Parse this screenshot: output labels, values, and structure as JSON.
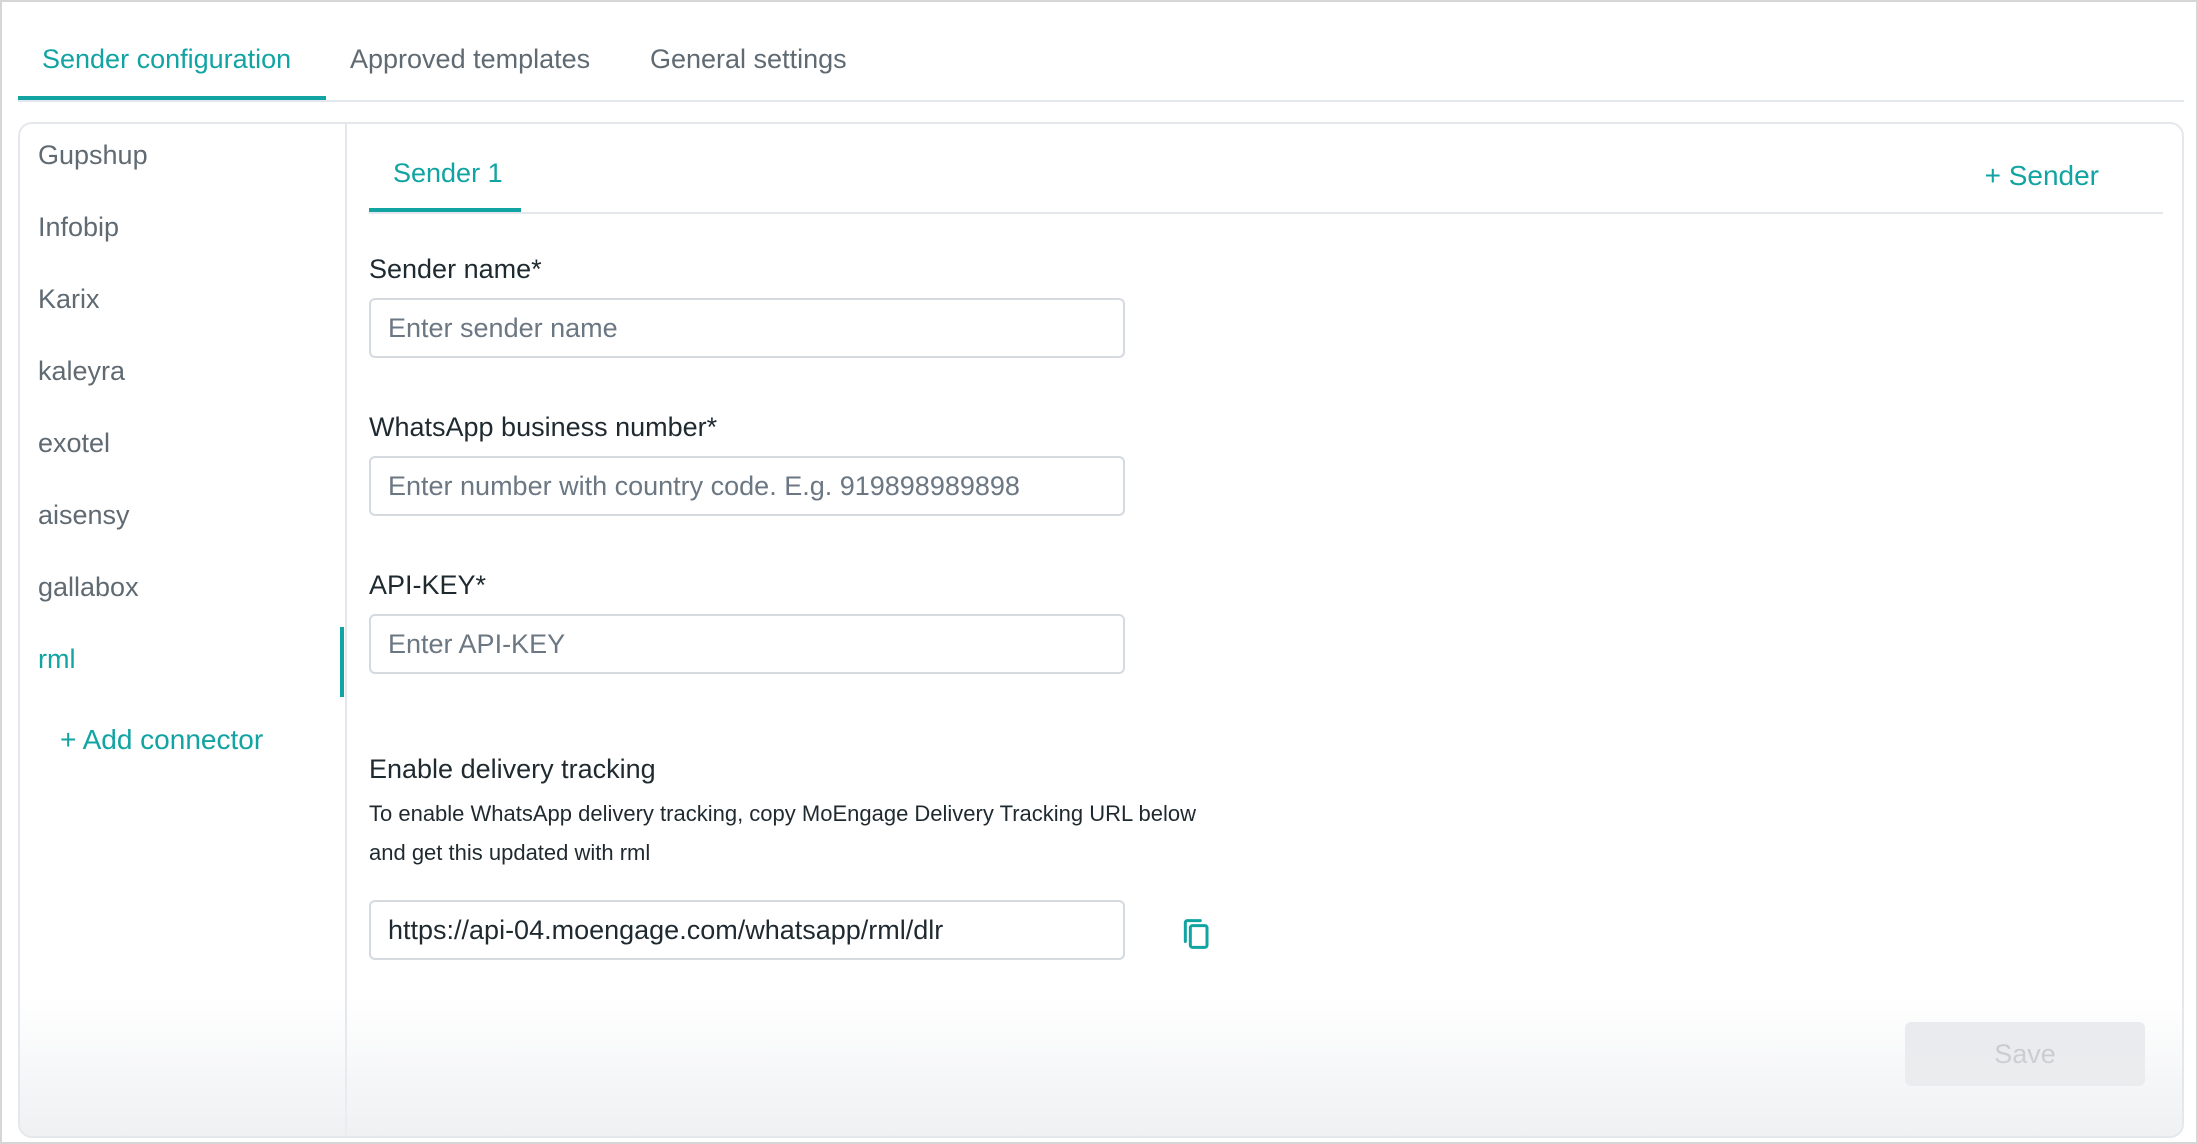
{
  "top_tabs": [
    {
      "label": "Sender configuration",
      "active": true
    },
    {
      "label": "Approved templates",
      "active": false
    },
    {
      "label": "General settings",
      "active": false
    }
  ],
  "sidebar": {
    "items": [
      {
        "label": "Gupshup"
      },
      {
        "label": "Infobip"
      },
      {
        "label": "Karix"
      },
      {
        "label": "kaleyra"
      },
      {
        "label": "exotel"
      },
      {
        "label": "aisensy"
      },
      {
        "label": "gallabox"
      },
      {
        "label": "rml",
        "active": true
      }
    ],
    "add_connector": "+ Add connector"
  },
  "sender_tabs": {
    "active": "Sender 1",
    "add_label": "+ Sender"
  },
  "form": {
    "sender_name_label": "Sender name*",
    "sender_name_placeholder": "Enter sender name",
    "number_label": "WhatsApp business number*",
    "number_placeholder": "Enter number with country code. E.g. 919898989898",
    "api_key_label": "API-KEY*",
    "api_key_placeholder": "Enter API-KEY",
    "tracking_title": "Enable delivery tracking",
    "tracking_desc_line1": "To enable WhatsApp delivery tracking, copy MoEngage Delivery Tracking URL below",
    "tracking_desc_line2": "and get this updated with rml",
    "tracking_url": "https://api-04.moengage.com/whatsapp/rml/dlr",
    "copy_icon": "copy-icon",
    "save_label": "Save"
  },
  "colors": {
    "accent": "#12a3a3",
    "border": "#d5dae1",
    "disabled_bg": "#e8eaed"
  }
}
